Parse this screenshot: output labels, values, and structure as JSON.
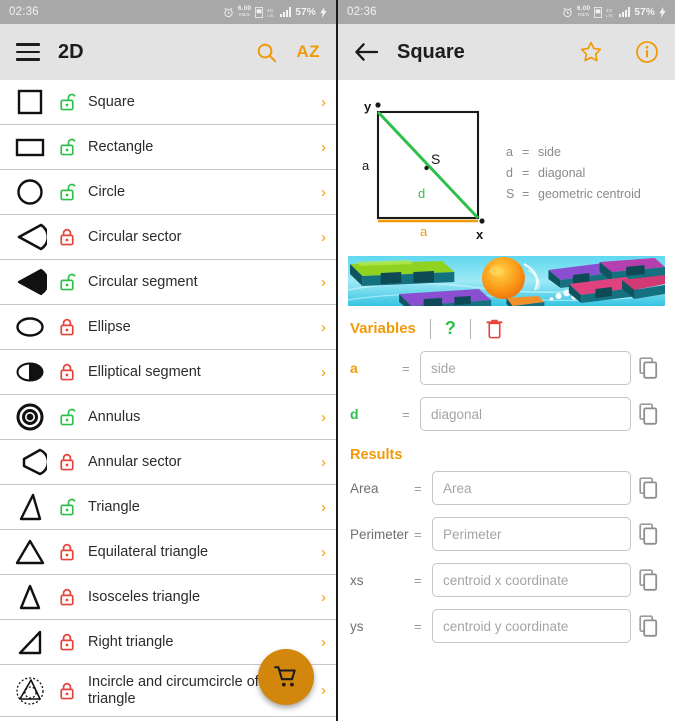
{
  "status_bar": {
    "time": "02:36",
    "data_rate_value": "6.00",
    "data_rate_unit": "KB/S",
    "battery": "57%"
  },
  "left_panel": {
    "appbar": {
      "title": "2D",
      "menu_icon": "hamburger-icon",
      "search_icon": "search-icon",
      "sort_label": "AZ"
    },
    "fab": {
      "icon": "shopping-cart-icon"
    },
    "items": [
      {
        "label": "Square",
        "shape": "square",
        "locked": false
      },
      {
        "label": "Rectangle",
        "shape": "rectangle",
        "locked": false
      },
      {
        "label": "Circle",
        "shape": "circle",
        "locked": false
      },
      {
        "label": "Circular sector",
        "shape": "circular-sector",
        "locked": true
      },
      {
        "label": "Circular segment",
        "shape": "circular-segment",
        "locked": false
      },
      {
        "label": "Ellipse",
        "shape": "ellipse",
        "locked": true
      },
      {
        "label": "Elliptical segment",
        "shape": "elliptical-segment",
        "locked": true
      },
      {
        "label": "Annulus",
        "shape": "annulus",
        "locked": false
      },
      {
        "label": "Annular sector",
        "shape": "annular-sector",
        "locked": true
      },
      {
        "label": "Triangle",
        "shape": "triangle",
        "locked": false
      },
      {
        "label": "Equilateral triangle",
        "shape": "equilateral-triangle",
        "locked": true
      },
      {
        "label": "Isosceles triangle",
        "shape": "isosceles-triangle",
        "locked": true
      },
      {
        "label": "Right triangle",
        "shape": "right-triangle",
        "locked": true
      },
      {
        "label": "Incircle and circumcircle of a triangle",
        "shape": "incircle-circumcircle",
        "locked": true
      }
    ],
    "chevron": "›"
  },
  "right_panel": {
    "appbar": {
      "title": "Square",
      "back_icon": "back-arrow-icon",
      "favorite_icon": "star-icon",
      "info_icon": "info-icon"
    },
    "diagram": {
      "axis_y": "y",
      "axis_x": "x",
      "side_label_left": "a",
      "side_label_bottom": "a",
      "diagonal_label": "d",
      "centroid_label": "S",
      "legend": [
        {
          "symbol": "a",
          "eq": "=",
          "text": "side"
        },
        {
          "symbol": "d",
          "eq": "=",
          "text": "diagonal"
        },
        {
          "symbol": "S",
          "eq": "=",
          "text": "geometric centroid"
        }
      ]
    },
    "variables": {
      "title": "Variables",
      "help_label": "?",
      "clear_icon": "trash-icon",
      "fields": [
        {
          "name": "a",
          "eq": "=",
          "placeholder": "side",
          "value": "",
          "color": "#f09a0a"
        },
        {
          "name": "d",
          "eq": "=",
          "placeholder": "diagonal",
          "value": "",
          "color": "#2fbf4b"
        }
      ]
    },
    "results": {
      "title": "Results",
      "fields": [
        {
          "name": "Area",
          "eq": "=",
          "placeholder": "Area",
          "value": ""
        },
        {
          "name": "Perimeter",
          "eq": "=",
          "placeholder": "Perimeter",
          "value": ""
        },
        {
          "name": "xs",
          "eq": "=",
          "placeholder": "centroid x coordinate",
          "value": ""
        },
        {
          "name": "ys",
          "eq": "=",
          "placeholder": "centroid y coordinate",
          "value": ""
        }
      ]
    },
    "copy_icon": "copy-icon"
  },
  "colors": {
    "accent_orange": "#f09a0a",
    "green": "#2fbf4b",
    "red": "#e8433a",
    "statusbar_gray": "#a8a8a8",
    "appbar_gray": "#e3e3e3"
  }
}
